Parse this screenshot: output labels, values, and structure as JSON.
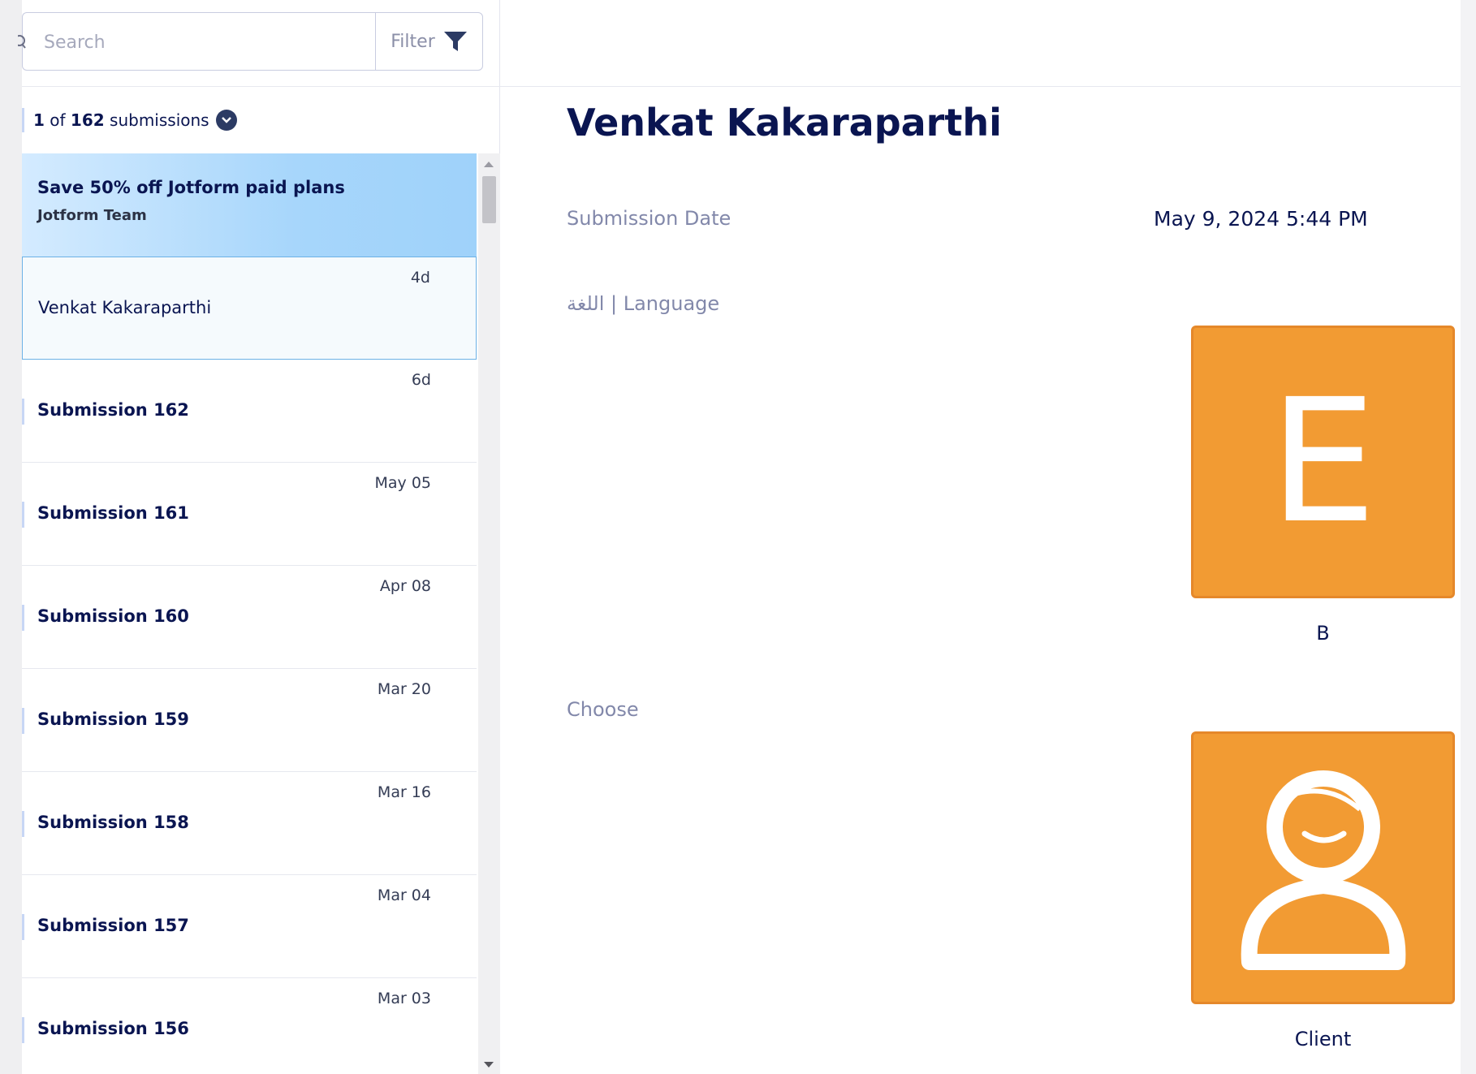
{
  "search": {
    "placeholder": "Search",
    "filter_label": "Filter"
  },
  "count": {
    "current": "1",
    "of": "of",
    "total": "162",
    "unit": "submissions"
  },
  "promo": {
    "title": "Save 50% off Jotform paid plans",
    "subtitle": "Jotform Team"
  },
  "submissions": [
    {
      "name": "Venkat Kakaraparthi",
      "date": "4d",
      "selected": true
    },
    {
      "name": "Submission 162",
      "date": "6d"
    },
    {
      "name": "Submission 161",
      "date": "May 05"
    },
    {
      "name": "Submission 160",
      "date": "Apr 08"
    },
    {
      "name": "Submission 159",
      "date": "Mar 20"
    },
    {
      "name": "Submission 158",
      "date": "Mar 16"
    },
    {
      "name": "Submission 157",
      "date": "Mar 04"
    },
    {
      "name": "Submission 156",
      "date": "Mar 03"
    }
  ],
  "detail": {
    "title": "Venkat Kakaraparthi",
    "submission_date_label": "Submission Date",
    "submission_date_value": "May 9, 2024 5:44 PM",
    "language_label": "اللغة | Language",
    "language_card_letter": "E",
    "language_caption": "B",
    "choose_label": "Choose",
    "choose_card_icon": "person-icon",
    "choose_caption": "Client"
  },
  "colors": {
    "accent_navy": "#0a1551",
    "card_orange": "#f29b33",
    "promo_blue": "#a7d6fb",
    "selected_border": "#6cb1e6"
  }
}
